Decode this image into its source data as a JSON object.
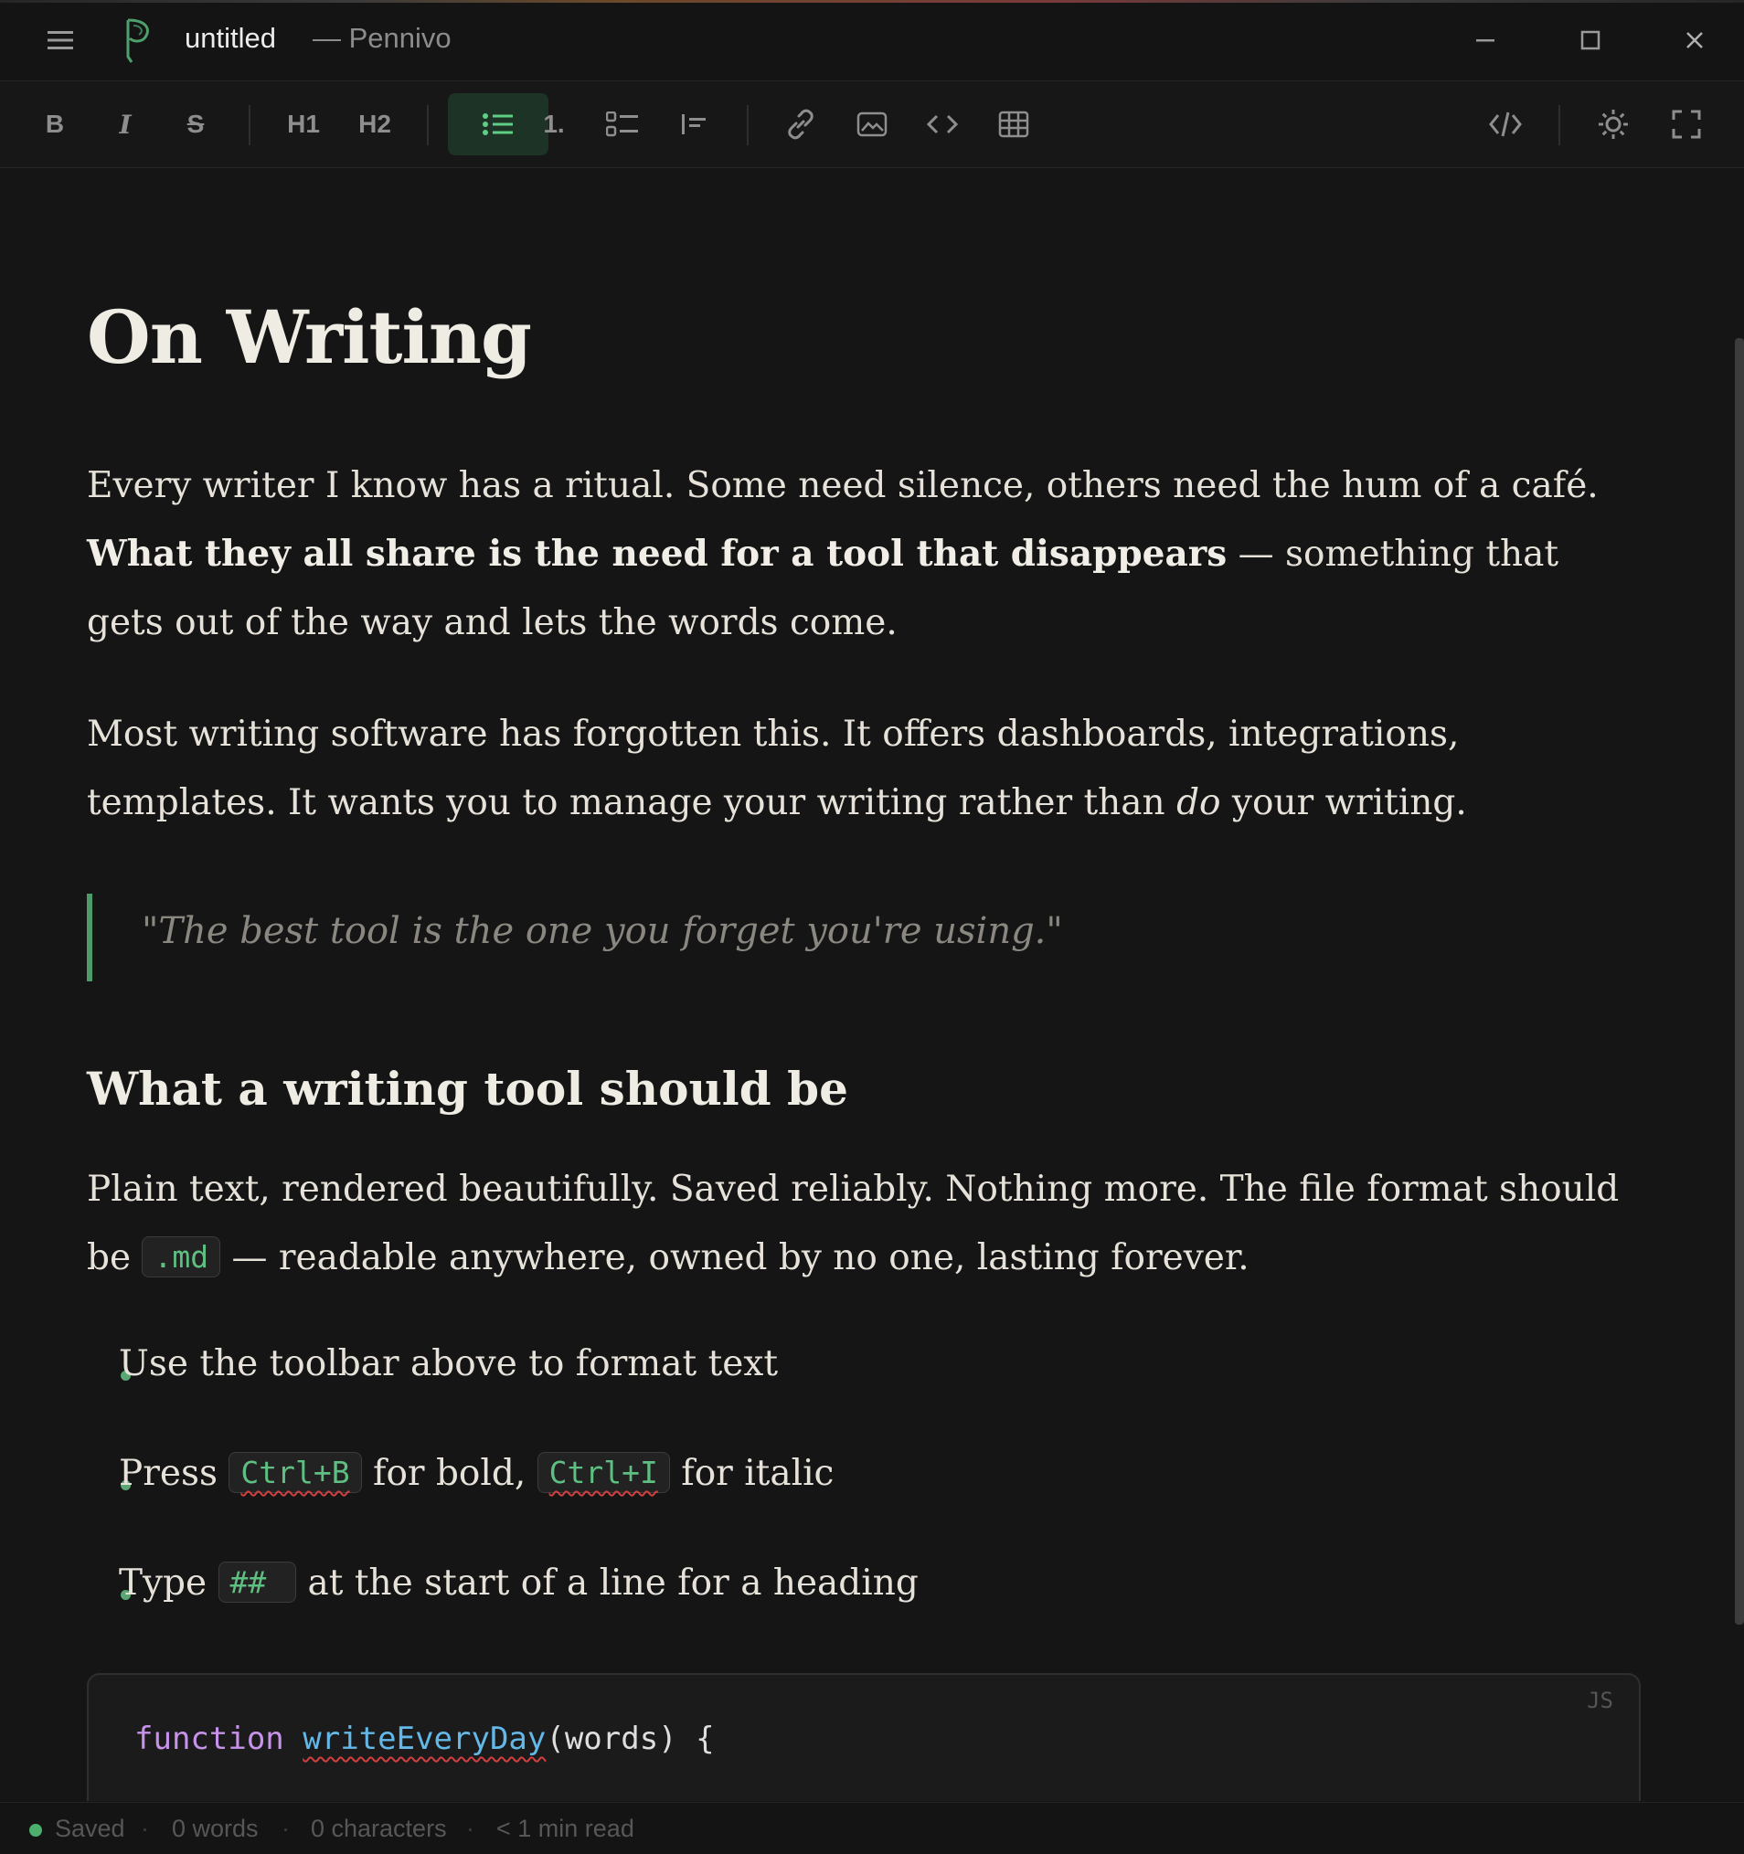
{
  "titlebar": {
    "doc_title": "untitled",
    "app_name": "— Pennivo"
  },
  "toolbar": {
    "bold": "B",
    "italic": "I",
    "strike": "S",
    "h1": "H1",
    "h2": "H2",
    "ordered": "1.",
    "active_tool": "bullet-list"
  },
  "document": {
    "title": "On Writing",
    "p1_a": "Every writer I know has a ritual. Some need silence, others need the hum of a café. ",
    "p1_bold": "What they all share is the need for a tool that disappears",
    "p1_b": " — something that gets out of the way and lets the words come.",
    "p2_a": "Most writing software has forgotten this. It offers dashboards, integrations, templates. It wants you to manage your writing rather than ",
    "p2_em": "do",
    "p2_b": " your writing.",
    "quote": "\"The best tool is the one you forget you're using.\"",
    "heading2": "What a writing tool should be",
    "p3_a": "Plain text, rendered beautifully. Saved reliably. Nothing more. The file format should be ",
    "p3_code": ".md",
    "p3_b": " — readable anywhere, owned by no one, lasting forever.",
    "bullet1": "Use the toolbar above to format text",
    "bullet2_a": "Press ",
    "bullet2_code1": "Ctrl+B",
    "bullet2_b": " for bold, ",
    "bullet2_code2": "Ctrl+I",
    "bullet2_c": " for italic",
    "bullet3_a": "Type ",
    "bullet3_code": "## ",
    "bullet3_b": " at the start of a line for a heading",
    "code_lang": "JS",
    "code_kw": "function",
    "code_fn": "writeEveryDay",
    "code_rest": "(words) {"
  },
  "statusbar": {
    "saved": "Saved",
    "words": "0 words",
    "characters": "0 characters",
    "read_time": "< 1 min read",
    "separator": "·"
  },
  "colors": {
    "accent": "#5fcf86",
    "background": "#151515"
  }
}
